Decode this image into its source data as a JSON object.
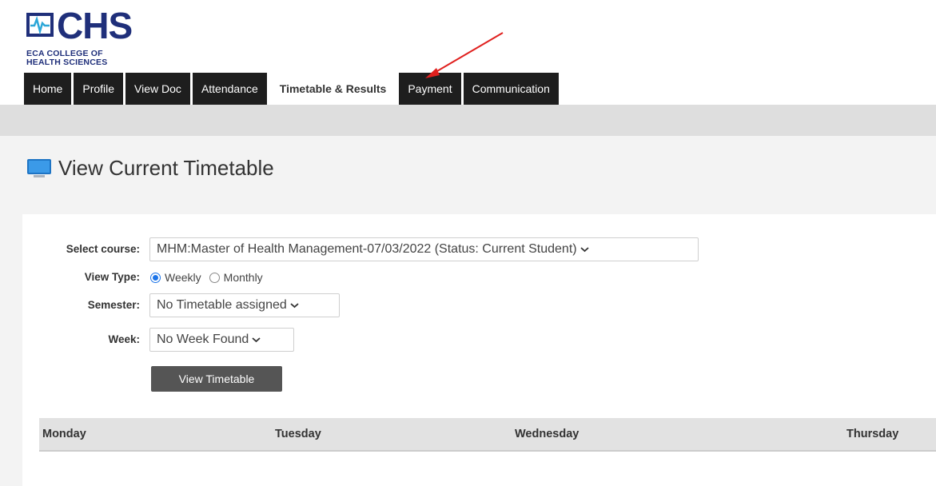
{
  "logo": {
    "mark": "CHS",
    "line1": "ECA COLLEGE OF",
    "line2": "HEALTH SCIENCES"
  },
  "nav": {
    "tabs": [
      {
        "label": "Home"
      },
      {
        "label": "Profile"
      },
      {
        "label": "View Doc"
      },
      {
        "label": "Attendance"
      },
      {
        "label": "Timetable & Results",
        "active": true
      },
      {
        "label": "Payment"
      },
      {
        "label": "Communication"
      }
    ]
  },
  "page": {
    "title": "View Current Timetable",
    "icon": "monitor-icon"
  },
  "form": {
    "course_label": "Select course:",
    "course_value": "MHM:Master of Health Management-07/03/2022 (Status: Current Student)",
    "view_type_label": "View Type:",
    "view_type_options": [
      "Weekly",
      "Monthly"
    ],
    "view_type_selected": "Weekly",
    "semester_label": "Semester:",
    "semester_value": "No Timetable assigned",
    "week_label": "Week:",
    "week_value": "No Week Found",
    "button": "View Timetable"
  },
  "timetable": {
    "days": [
      "Monday",
      "Tuesday",
      "Wednesday",
      "Thursday"
    ]
  },
  "colors": {
    "nav_bg": "#1e1e1e",
    "brand": "#1f2f7a",
    "radio_accent": "#1a73e8",
    "annotation_arrow": "#e0201e"
  }
}
